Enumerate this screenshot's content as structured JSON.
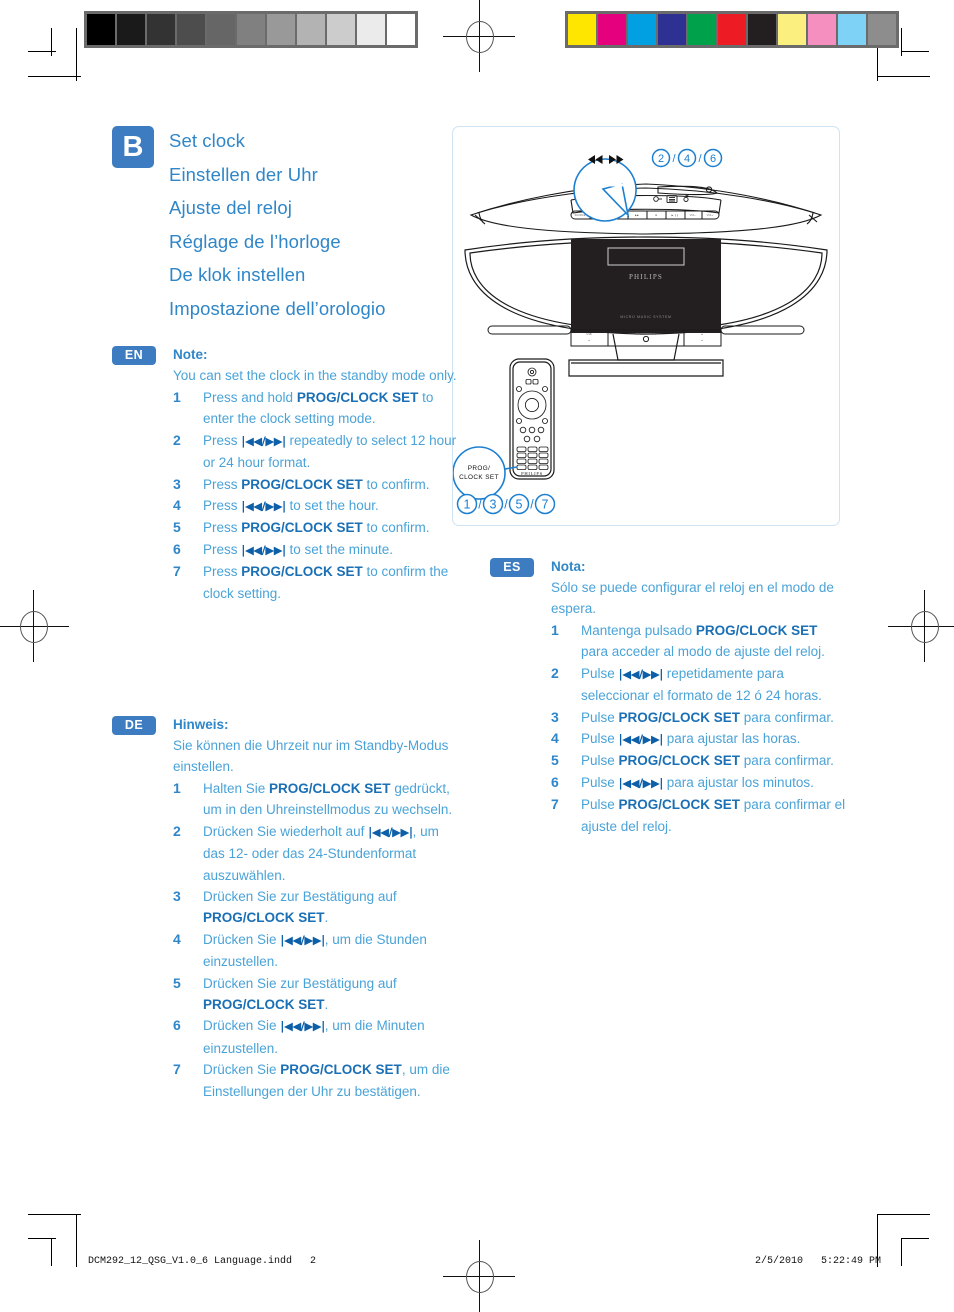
{
  "section": {
    "letter": "B",
    "titles": [
      "Set clock",
      "Einstellen der Uhr",
      "Ajuste del reloj",
      "Réglage de l’horloge",
      "De klok instellen",
      "Impostazione dell’orologio"
    ]
  },
  "colors": {
    "badge_blue": "#3d7cc0",
    "title_blue": "#2f86c8",
    "body_blue": "#4aa3d8",
    "bold_blue": "#1b6fb5",
    "panel_border": "#cfe3f2"
  },
  "languages": [
    {
      "tag": "EN",
      "note_label": "Note:",
      "note_text": "You can set the clock in the standby mode only.",
      "steps": [
        {
          "num": "1",
          "parts": [
            {
              "t": "Press and hold ",
              "b": false
            },
            {
              "t": "PROG/CLOCK SET",
              "b": true
            },
            {
              "t": " to enter the clock setting mode.",
              "b": false
            }
          ]
        },
        {
          "num": "2",
          "parts": [
            {
              "t": "Press ",
              "b": false
            },
            {
              "t": "|◀◀/▶▶|",
              "k": true
            },
            {
              "t": " repeatedly to select 12 hour or 24 hour format.",
              "b": false
            }
          ]
        },
        {
          "num": "3",
          "parts": [
            {
              "t": "Press ",
              "b": false
            },
            {
              "t": "PROG/CLOCK SET",
              "b": true
            },
            {
              "t": " to confirm.",
              "b": false
            }
          ]
        },
        {
          "num": "4",
          "parts": [
            {
              "t": "Press ",
              "b": false
            },
            {
              "t": "|◀◀/▶▶|",
              "k": true
            },
            {
              "t": " to set the hour.",
              "b": false
            }
          ]
        },
        {
          "num": "5",
          "parts": [
            {
              "t": "Press ",
              "b": false
            },
            {
              "t": "PROG/CLOCK SET",
              "b": true
            },
            {
              "t": " to confirm.",
              "b": false
            }
          ]
        },
        {
          "num": "6",
          "parts": [
            {
              "t": "Press ",
              "b": false
            },
            {
              "t": "|◀◀/▶▶|",
              "k": true
            },
            {
              "t": " to set the minute.",
              "b": false
            }
          ]
        },
        {
          "num": "7",
          "parts": [
            {
              "t": "Press ",
              "b": false
            },
            {
              "t": "PROG/CLOCK SET",
              "b": true
            },
            {
              "t": " to confirm the clock setting.",
              "b": false
            }
          ]
        }
      ]
    },
    {
      "tag": "DE",
      "note_label": "Hinweis:",
      "note_text": "Sie können die Uhrzeit nur im Standby-Modus einstellen.",
      "steps": [
        {
          "num": "1",
          "parts": [
            {
              "t": "Halten Sie ",
              "b": false
            },
            {
              "t": "PROG/CLOCK SET",
              "b": true
            },
            {
              "t": " gedrückt, um in den Uhreinstellmodus zu wechseln.",
              "b": false
            }
          ]
        },
        {
          "num": "2",
          "parts": [
            {
              "t": "Drücken Sie wiederholt auf ",
              "b": false
            },
            {
              "t": "|◀◀/▶▶|",
              "k": true
            },
            {
              "t": ", um das 12- oder das 24-Stundenformat auszuwählen.",
              "b": false
            }
          ]
        },
        {
          "num": "3",
          "parts": [
            {
              "t": "Drücken Sie zur Bestätigung auf ",
              "b": false
            },
            {
              "t": "PROG/CLOCK SET",
              "b": true
            },
            {
              "t": ".",
              "b": false
            }
          ]
        },
        {
          "num": "4",
          "parts": [
            {
              "t": "Drücken Sie ",
              "b": false
            },
            {
              "t": "|◀◀/▶▶|",
              "k": true
            },
            {
              "t": ", um die Stunden einzustellen.",
              "b": false
            }
          ]
        },
        {
          "num": "5",
          "parts": [
            {
              "t": "Drücken Sie zur Bestätigung auf ",
              "b": false
            },
            {
              "t": "PROG/CLOCK SET",
              "b": true
            },
            {
              "t": ".",
              "b": false
            }
          ]
        },
        {
          "num": "6",
          "parts": [
            {
              "t": "Drücken Sie ",
              "b": false
            },
            {
              "t": "|◀◀/▶▶|",
              "k": true
            },
            {
              "t": ", um die Minuten einzustellen.",
              "b": false
            }
          ]
        },
        {
          "num": "7",
          "parts": [
            {
              "t": "Drücken Sie ",
              "b": false
            },
            {
              "t": "PROG/CLOCK SET",
              "b": true
            },
            {
              "t": ", um die Einstellungen der Uhr zu bestätigen.",
              "b": false
            }
          ]
        }
      ]
    },
    {
      "tag": "ES",
      "note_label": "Nota:",
      "note_text": "Sólo se puede configurar el reloj en el modo de espera.",
      "steps": [
        {
          "num": "1",
          "parts": [
            {
              "t": "Mantenga pulsado ",
              "b": false
            },
            {
              "t": "PROG/CLOCK SET",
              "b": true
            },
            {
              "t": " para acceder al modo de ajuste del reloj.",
              "b": false
            }
          ]
        },
        {
          "num": "2",
          "parts": [
            {
              "t": "Pulse ",
              "b": false
            },
            {
              "t": "|◀◀/▶▶|",
              "k": true
            },
            {
              "t": " repetidamente para seleccionar el formato de 12 ó 24 horas.",
              "b": false
            }
          ]
        },
        {
          "num": "3",
          "parts": [
            {
              "t": "Pulse ",
              "b": false
            },
            {
              "t": "PROG/CLOCK SET",
              "b": true
            },
            {
              "t": " para confirmar.",
              "b": false
            }
          ]
        },
        {
          "num": "4",
          "parts": [
            {
              "t": "Pulse ",
              "b": false
            },
            {
              "t": "|◀◀/▶▶|",
              "k": true
            },
            {
              "t": " para ajustar las horas.",
              "b": false
            }
          ]
        },
        {
          "num": "5",
          "parts": [
            {
              "t": "Pulse ",
              "b": false
            },
            {
              "t": "PROG/CLOCK SET",
              "b": true
            },
            {
              "t": " para confirmar.",
              "b": false
            }
          ]
        },
        {
          "num": "6",
          "parts": [
            {
              "t": "Pulse ",
              "b": false
            },
            {
              "t": "|◀◀/▶▶|",
              "k": true
            },
            {
              "t": " para ajustar los minutos.",
              "b": false
            }
          ]
        },
        {
          "num": "7",
          "parts": [
            {
              "t": "Pulse ",
              "b": false
            },
            {
              "t": "PROG/CLOCK SET",
              "b": true
            },
            {
              "t": " para confirmar el ajuste del reloj.",
              "b": false
            }
          ]
        }
      ]
    }
  ],
  "illustration": {
    "top_callout_numbers": [
      "2",
      "4",
      "6"
    ],
    "bottom_callout_numbers": [
      "1",
      "3",
      "5",
      "7"
    ],
    "callout_separator": "/",
    "bubble_skip_label": "|◀◀  ▶▶|",
    "bubble_prog_label_line1": "PROG/",
    "bubble_prog_label_line2": "CLOCK SET",
    "brand": "PHILIPS"
  },
  "footer": {
    "file": "DCM292_12_QSG_V1.0_6 Language.indd   2",
    "timestamp": "2/5/2010   5:22:49 PM"
  },
  "print_strips": {
    "grayscale": [
      "#000000",
      "#1a1a1a",
      "#333333",
      "#4d4d4d",
      "#666666",
      "#808080",
      "#999999",
      "#b3b3b3",
      "#cccccc",
      "#ebebeb",
      "#ffffff"
    ],
    "colors": [
      "#ffe600",
      "#e5007d",
      "#00a0e3",
      "#2e3192",
      "#00a14b",
      "#ed1c24",
      "#231f20",
      "#fbf07f",
      "#f48fc0",
      "#7ed2f5",
      "#8d8d8d"
    ]
  }
}
